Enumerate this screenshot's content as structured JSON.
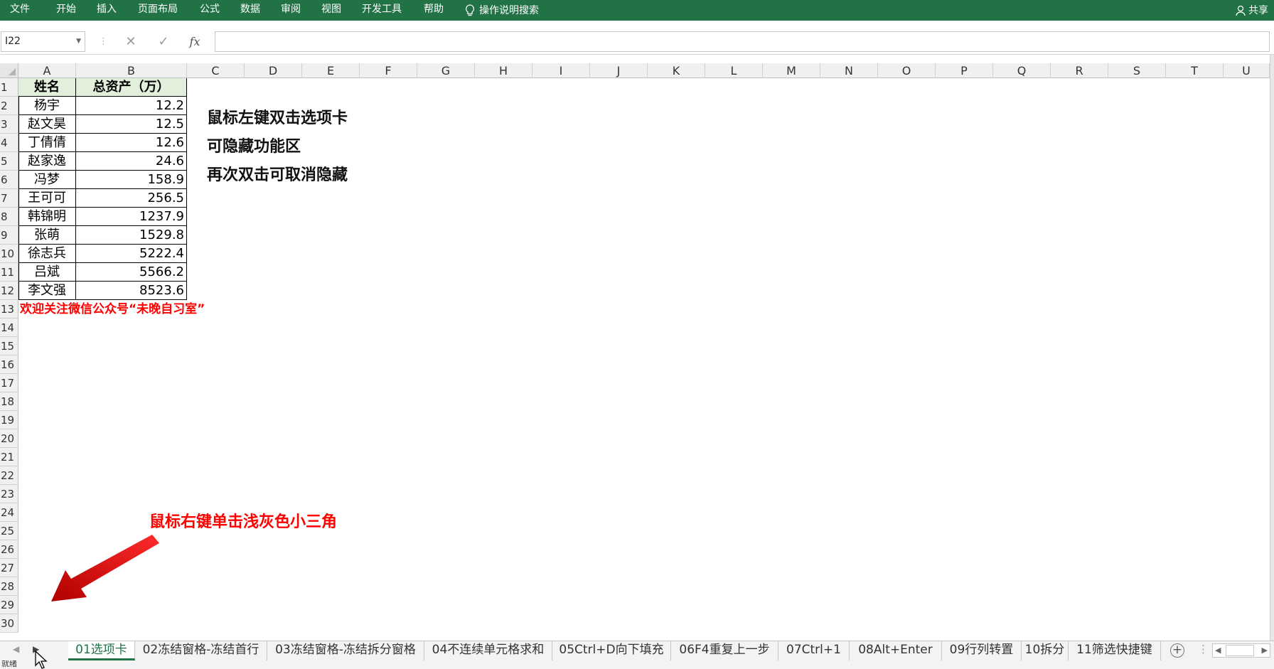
{
  "ribbon": {
    "tabs": [
      "文件",
      "开始",
      "插入",
      "页面布局",
      "公式",
      "数据",
      "审阅",
      "视图",
      "开发工具",
      "帮助"
    ],
    "tell_me": "操作说明搜索",
    "share": "共享"
  },
  "formula_bar": {
    "name_box": "I22",
    "formula": ""
  },
  "columns": [
    "A",
    "B",
    "C",
    "D",
    "E",
    "F",
    "G",
    "H",
    "I",
    "J",
    "K",
    "L",
    "M",
    "N",
    "O",
    "P",
    "Q",
    "R",
    "S",
    "T",
    "U"
  ],
  "rows": [
    "1",
    "2",
    "3",
    "4",
    "5",
    "6",
    "7",
    "8",
    "9",
    "10",
    "11",
    "12",
    "13",
    "14",
    "15",
    "16",
    "17",
    "18",
    "19",
    "20",
    "21",
    "22",
    "23",
    "24",
    "25",
    "26",
    "27",
    "28",
    "29",
    "30"
  ],
  "table": {
    "headers": [
      "姓名",
      "总资产（万）"
    ],
    "rows": [
      {
        "name": "杨宇",
        "value": "12.2"
      },
      {
        "name": "赵文昊",
        "value": "12.5"
      },
      {
        "name": "丁倩倩",
        "value": "12.6"
      },
      {
        "name": "赵家逸",
        "value": "24.6"
      },
      {
        "name": "冯梦",
        "value": "158.9"
      },
      {
        "name": "王可可",
        "value": "256.5"
      },
      {
        "name": "韩锦明",
        "value": "1237.9"
      },
      {
        "name": "张萌",
        "value": "1529.8"
      },
      {
        "name": "徐志兵",
        "value": "5222.4"
      },
      {
        "name": "吕斌",
        "value": "5566.2"
      },
      {
        "name": "李文强",
        "value": "8523.6"
      }
    ]
  },
  "notes": {
    "wechat": "欢迎关注微信公众号“未晚自习室”",
    "tip_line1": "鼠标左键双击选项卡",
    "tip_line2": "可隐藏功能区",
    "tip_line3": "再次双击可取消隐藏",
    "tip_right_click": "鼠标右键单击浅灰色小三角"
  },
  "sheet_tabs": [
    "01选项卡",
    "02冻结窗格-冻结首行",
    "03冻结窗格-冻结拆分窗格",
    "04不连续单元格求和",
    "05Ctrl+D向下填充",
    "06F4重复上一步",
    "07Ctrl+1",
    "08Alt+Enter",
    "09行列转置",
    "10拆分",
    "11筛选快捷键"
  ],
  "status": {
    "mode": "就绪"
  },
  "colors": {
    "ribbon": "#217346",
    "header_fill": "#e2efda",
    "note_red": "#ff0000",
    "arrow_red": "#e00000"
  }
}
